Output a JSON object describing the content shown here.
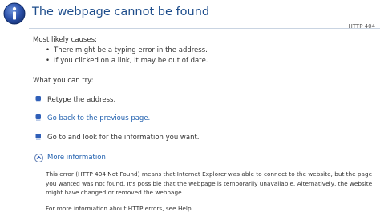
{
  "header": {
    "title": "The webpage cannot be found",
    "status_code": "HTTP 404",
    "icon": "info-icon",
    "accent_color": "#1f4e8c"
  },
  "causes": {
    "label": "Most likely causes:",
    "items": [
      "There might be a typing error in the address.",
      "If you clicked on a link, it may be out of date."
    ]
  },
  "actions": {
    "label": "What you can try:",
    "retype": "Retype the address.",
    "go_back": "Go back to the previous page.",
    "go_to": "Go to  and look for the information you want.",
    "bullet_icon": "blue-bullet-icon",
    "link_color": "#1f5fae"
  },
  "more_info": {
    "label": "More information",
    "icon": "expand-arrow-icon",
    "detail": "This error (HTTP 404 Not Found) means that Internet Explorer was able to connect to the website, but the page you wanted was not found. It's possible that the webpage is temporarily unavailable. Alternatively, the website might have changed or removed the webpage.",
    "help": "For more information about HTTP errors, see Help."
  }
}
